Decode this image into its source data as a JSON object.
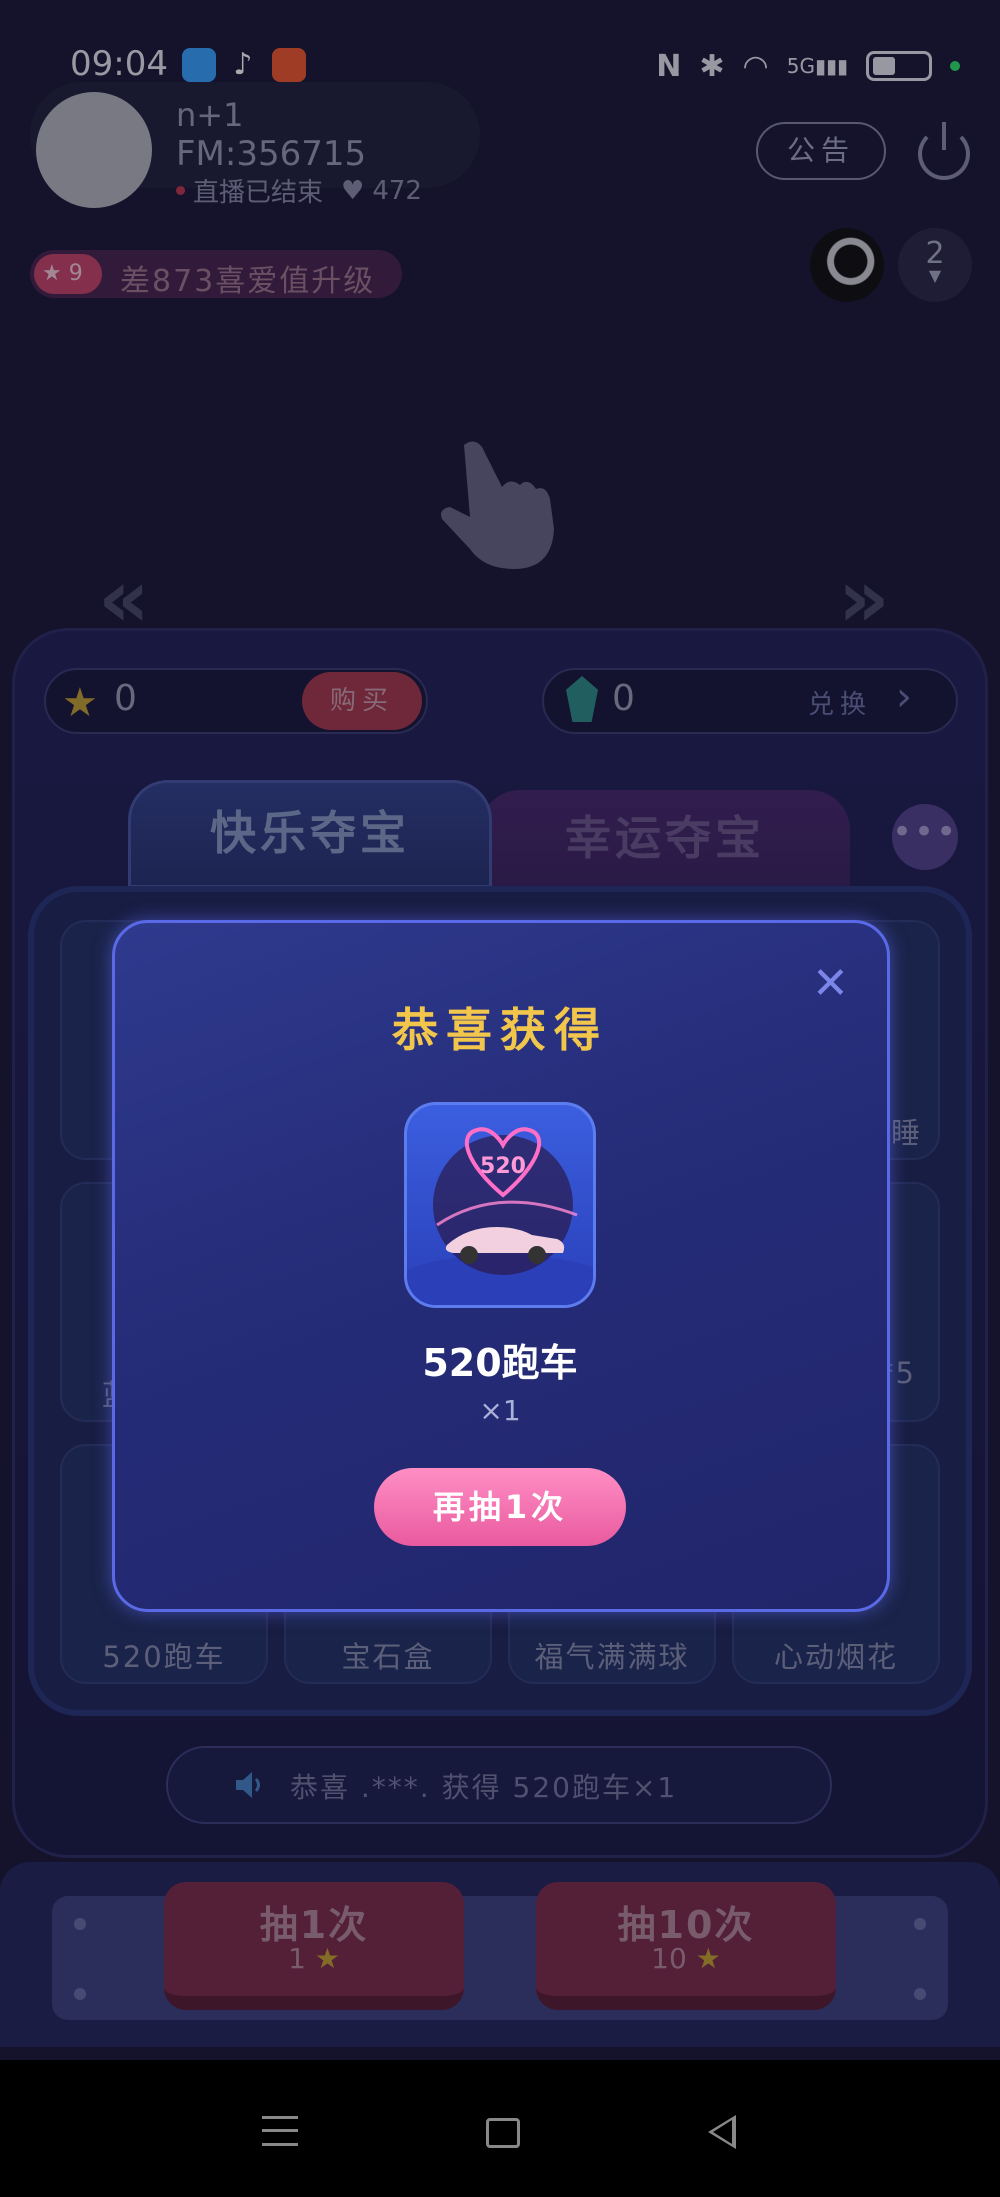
{
  "status_bar": {
    "time": "09:04",
    "network": "5G",
    "app_icons": [
      "bluesky-app-icon",
      "tiktok-app-icon",
      "app-grid-icon"
    ]
  },
  "anchor": {
    "name": "n+1",
    "fm_id": "FM:356715",
    "live_status": "直播已结束",
    "likes": "472"
  },
  "header": {
    "notice_label": "公告",
    "level": "9",
    "level_text": "差873喜爱值升级",
    "viewer_count": "2"
  },
  "wallet": {
    "stars": "0",
    "buy_label": "购买",
    "gems": "0",
    "exchange_label": "兑换"
  },
  "tabs": [
    {
      "label": "快乐夺宝",
      "active": true
    },
    {
      "label": "幸运夺宝",
      "active": false
    }
  ],
  "more_label": "•••",
  "grid_items": [
    {
      "label": ""
    },
    {
      "label": ""
    },
    {
      "label": ""
    },
    {
      "label": "睡"
    },
    {
      "label": "蓝"
    },
    {
      "label": ""
    },
    {
      "label": ""
    },
    {
      "label": "*5"
    },
    {
      "label": "520跑车"
    },
    {
      "label": "宝石盒"
    },
    {
      "label": "福气满满球"
    },
    {
      "label": "心动烟花"
    }
  ],
  "marquee": {
    "text": "恭喜 .***. 获得 520跑车×1"
  },
  "draw_buttons": [
    {
      "label": "抽1次",
      "cost": "1"
    },
    {
      "label": "抽10次",
      "cost": "10"
    }
  ],
  "modal": {
    "title": "恭喜获得",
    "prize_name": "520跑车",
    "prize_badge": "520",
    "prize_qty": "×1",
    "again_label": "再抽1次"
  },
  "colors": {
    "accent_pink": "#e95a9f",
    "title_gold": "#f2c64b",
    "modal_border": "#5a6ae6"
  }
}
